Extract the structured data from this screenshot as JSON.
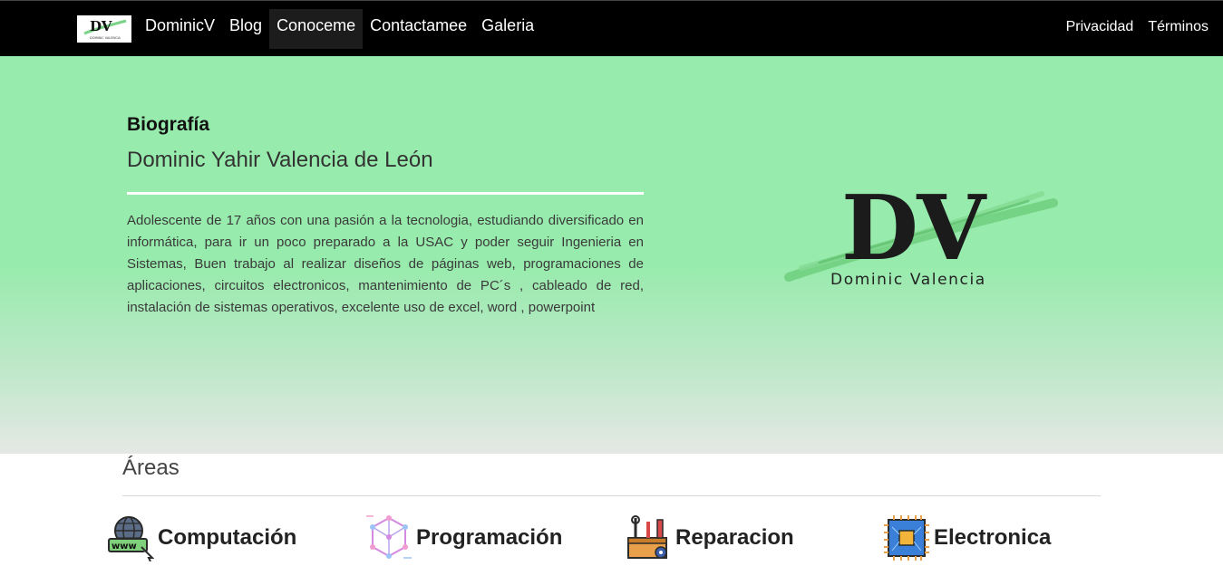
{
  "nav": {
    "brand_logo": {
      "initials": "DV",
      "subtext": "DOMINIC VALENCIA"
    },
    "links": [
      "DominicV",
      "Blog",
      "Conoceme",
      "Contactamee",
      "Galeria"
    ],
    "active_link": "Conoceme",
    "right_links": [
      "Privacidad",
      "Términos"
    ]
  },
  "bio": {
    "heading": "Biografía",
    "name": "Dominic Yahir Valencia de León",
    "text": "Adolescente de 17 años con una pasión a la tecnologia, estudiando diversificado en informática, para ir un poco preparado a la USAC y poder seguir Ingenieria en Sistemas, Buen trabajo al realizar diseños de páginas web, programaciones de aplicaciones, circuitos electronicos, mantenimiento de PC´s , cableado de red, instalación de sistemas operativos, excelente uso de excel, word , powerpoint"
  },
  "hero_logo": {
    "initials": "DV",
    "caption": "Dominic Valencia"
  },
  "areas": {
    "title": "Áreas",
    "items": [
      {
        "label": "Computación",
        "icon": "globe-www-icon"
      },
      {
        "label": "Programación",
        "icon": "cube-network-icon"
      },
      {
        "label": "Reparacion",
        "icon": "toolbox-icon"
      },
      {
        "label": "Electronica",
        "icon": "microchip-icon"
      }
    ]
  },
  "colors": {
    "navbar": "#000000",
    "hero_green": "#97ebac",
    "hero_fade": "#e5e8e5",
    "brush_stroke": "#6fcf7e"
  }
}
